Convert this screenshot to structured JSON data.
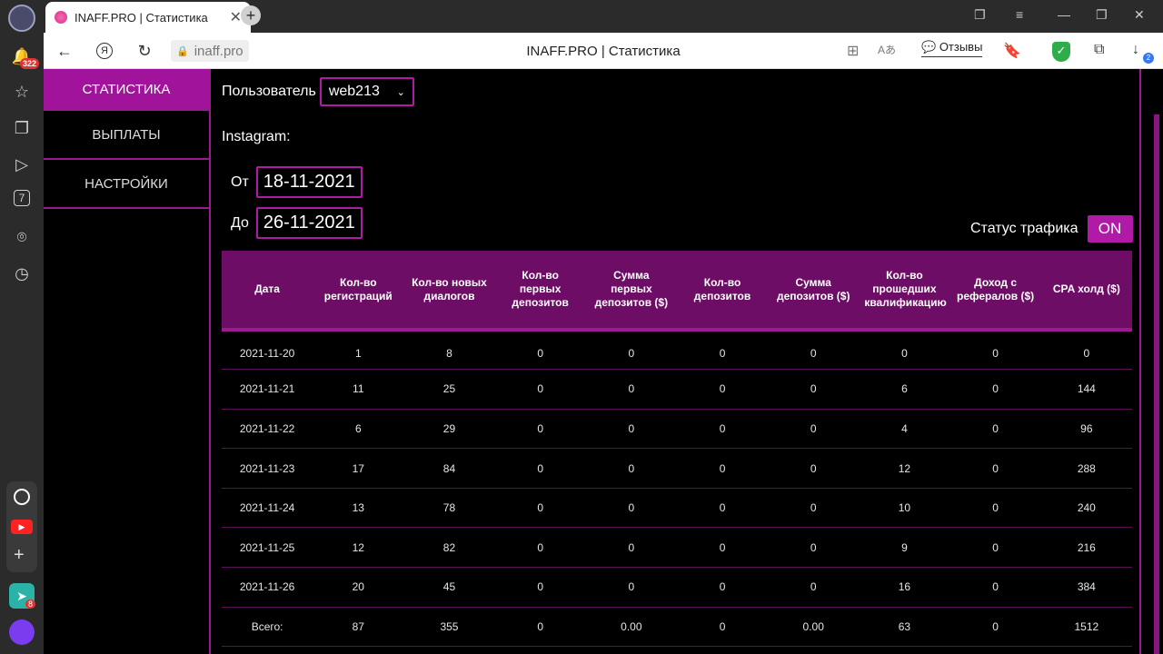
{
  "browser": {
    "tab_title": "INAFF.PRO | Статистика",
    "url": "inaff.pro",
    "page_title": "INAFF.PRO | Статистика",
    "reviews_label": "Отзывы",
    "notification_count": "322",
    "app_badge": "8",
    "download_badge": "2",
    "calendar_day": "7"
  },
  "menu": {
    "items": [
      {
        "label": "СТАТИСТИКА"
      },
      {
        "label": "ВЫПЛАТЫ"
      },
      {
        "label": "НАСТРОЙКИ"
      }
    ]
  },
  "filters": {
    "user_label": "Пользователь",
    "user_value": "web213",
    "section": "Instagram:",
    "from_label": "От",
    "from_value": "18-11-2021",
    "to_label": "До",
    "to_value": "26-11-2021",
    "traffic_label": "Статус трафика",
    "traffic_value": "ON"
  },
  "table": {
    "headers": [
      "Дата",
      "Кол-во регистраций",
      "Кол-во новых диалогов",
      "Кол-во первых депозитов",
      "Сумма первых депозитов ($)",
      "Кол-во депозитов",
      "Сумма депозитов ($)",
      "Кол-во прошедших квалификацию",
      "Доход с рефералов ($)",
      "CPA холд ($)"
    ],
    "rows": [
      [
        "2021-11-20",
        "1",
        "8",
        "0",
        "0",
        "0",
        "0",
        "0",
        "0",
        "0"
      ],
      [
        "2021-11-21",
        "11",
        "25",
        "0",
        "0",
        "0",
        "0",
        "6",
        "0",
        "144"
      ],
      [
        "2021-11-22",
        "6",
        "29",
        "0",
        "0",
        "0",
        "0",
        "4",
        "0",
        "96"
      ],
      [
        "2021-11-23",
        "17",
        "84",
        "0",
        "0",
        "0",
        "0",
        "12",
        "0",
        "288"
      ],
      [
        "2021-11-24",
        "13",
        "78",
        "0",
        "0",
        "0",
        "0",
        "10",
        "0",
        "240"
      ],
      [
        "2021-11-25",
        "12",
        "82",
        "0",
        "0",
        "0",
        "0",
        "9",
        "0",
        "216"
      ],
      [
        "2021-11-26",
        "20",
        "45",
        "0",
        "0",
        "0",
        "0",
        "16",
        "0",
        "384"
      ],
      [
        "Всего:",
        "87",
        "355",
        "0",
        "0.00",
        "0",
        "0.00",
        "63",
        "0",
        "1512"
      ]
    ]
  },
  "colors": {
    "accent": "#b01aa6",
    "header_bg": "#6e0d66",
    "background": "#000000"
  }
}
